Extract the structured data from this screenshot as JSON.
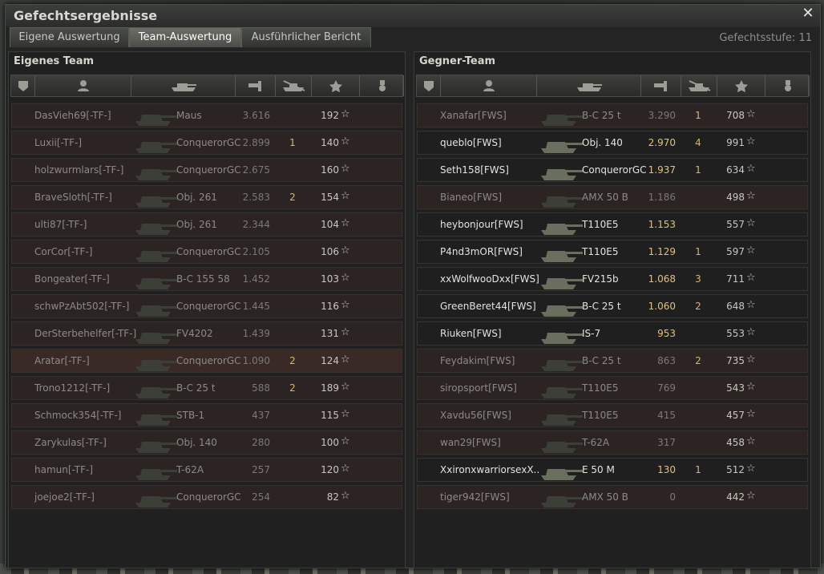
{
  "window": {
    "title": "Gefechtsergebnisse"
  },
  "tabs": [
    {
      "label": "Eigene Auswertung",
      "active": false
    },
    {
      "label": "Team-Auswertung",
      "active": true
    },
    {
      "label": "Ausführlicher Bericht",
      "active": false
    }
  ],
  "battle_tier": "Gefechtsstufe: 11",
  "columns": [
    "squad-icon",
    "player-icon",
    "vehicle-icon",
    "damage-icon",
    "kills-icon",
    "xp-star-icon",
    "medal-icon"
  ],
  "own_team": {
    "title": "Eigenes Team",
    "rows": [
      {
        "name": "DasVieh69[-TF-]",
        "tank": "Maus",
        "damage": "3.616",
        "kills": "",
        "xp": "192"
      },
      {
        "name": "Luxii[-TF-]",
        "tank": "ConquerorGC",
        "damage": "2.899",
        "kills": "1",
        "xp": "140"
      },
      {
        "name": "holzwurmlars[-TF-]",
        "tank": "ConquerorGC",
        "damage": "2.675",
        "kills": "",
        "xp": "160"
      },
      {
        "name": "BraveSloth[-TF-]",
        "tank": "Obj. 261",
        "damage": "2.583",
        "kills": "2",
        "xp": "154"
      },
      {
        "name": "ulti87[-TF-]",
        "tank": "Obj. 261",
        "damage": "2.344",
        "kills": "",
        "xp": "104"
      },
      {
        "name": "CorCor[-TF-]",
        "tank": "ConquerorGC",
        "damage": "2.105",
        "kills": "",
        "xp": "106"
      },
      {
        "name": "Bongeater[-TF-]",
        "tank": "B-C 155 58",
        "damage": "1.452",
        "kills": "",
        "xp": "103"
      },
      {
        "name": "schwPzAbt502[-TF-]",
        "tank": "ConquerorGC",
        "damage": "1.445",
        "kills": "",
        "xp": "116"
      },
      {
        "name": "DerSterbehelfer[-TF-]",
        "tank": "FV4202",
        "damage": "1.439",
        "kills": "",
        "xp": "131"
      },
      {
        "name": "Aratar[-TF-]",
        "tank": "ConquerorGC",
        "damage": "1.090",
        "kills": "2",
        "xp": "124"
      },
      {
        "name": "Trono1212[-TF-]",
        "tank": "B-C 25 t",
        "damage": "588",
        "kills": "2",
        "xp": "189"
      },
      {
        "name": "Schmock354[-TF-]",
        "tank": "STB-1",
        "damage": "437",
        "kills": "",
        "xp": "115"
      },
      {
        "name": "Zarykulas[-TF-]",
        "tank": "Obj. 140",
        "damage": "280",
        "kills": "",
        "xp": "100"
      },
      {
        "name": "hamun[-TF-]",
        "tank": "T-62A",
        "damage": "257",
        "kills": "",
        "xp": "120"
      },
      {
        "name": "joejoe2[-TF-]",
        "tank": "ConquerorGC",
        "damage": "254",
        "kills": "",
        "xp": "82"
      }
    ]
  },
  "enemy_team": {
    "title": "Gegner-Team",
    "rows": [
      {
        "name": "Xanafar[FWS]",
        "tank": "B-C 25 t",
        "damage": "3.290",
        "kills": "1",
        "xp": "708",
        "alive": false
      },
      {
        "name": "queblo[FWS]",
        "tank": "Obj. 140",
        "damage": "2.970",
        "kills": "4",
        "xp": "991",
        "alive": true
      },
      {
        "name": "Seth158[FWS]",
        "tank": "ConquerorGC",
        "damage": "1.937",
        "kills": "1",
        "xp": "634",
        "alive": true
      },
      {
        "name": "Bianeo[FWS]",
        "tank": "AMX 50 B",
        "damage": "1.186",
        "kills": "",
        "xp": "498",
        "alive": false
      },
      {
        "name": "heybonjour[FWS]",
        "tank": "T110E5",
        "damage": "1.153",
        "kills": "",
        "xp": "557",
        "alive": true
      },
      {
        "name": "P4nd3mOR[FWS]",
        "tank": "T110E5",
        "damage": "1.129",
        "kills": "1",
        "xp": "597",
        "alive": true
      },
      {
        "name": "xxWolfwooDxx[FWS]",
        "tank": "FV215b",
        "damage": "1.068",
        "kills": "3",
        "xp": "711",
        "alive": true
      },
      {
        "name": "GreenBeret44[FWS]",
        "tank": "B-C 25 t",
        "damage": "1.060",
        "kills": "2",
        "xp": "648",
        "alive": true
      },
      {
        "name": "Riuken[FWS]",
        "tank": "IS-7",
        "damage": "953",
        "kills": "",
        "xp": "553",
        "alive": true
      },
      {
        "name": "Feydakim[FWS]",
        "tank": "B-C 25 t",
        "damage": "863",
        "kills": "2",
        "xp": "735",
        "alive": false
      },
      {
        "name": "siropsport[FWS]",
        "tank": "T110E5",
        "damage": "769",
        "kills": "",
        "xp": "543",
        "alive": false
      },
      {
        "name": "Xavdu56[FWS]",
        "tank": "T110E5",
        "damage": "415",
        "kills": "",
        "xp": "457",
        "alive": false
      },
      {
        "name": "wan29[FWS]",
        "tank": "T-62A",
        "damage": "317",
        "kills": "",
        "xp": "458",
        "alive": false
      },
      {
        "name": "XxironxwarriorsexX..",
        "tank": "E 50 M",
        "damage": "130",
        "kills": "1",
        "xp": "512",
        "alive": true
      },
      {
        "name": "tiger942[FWS]",
        "tank": "AMX 50 B",
        "damage": "0",
        "kills": "",
        "xp": "442",
        "alive": false
      }
    ]
  }
}
